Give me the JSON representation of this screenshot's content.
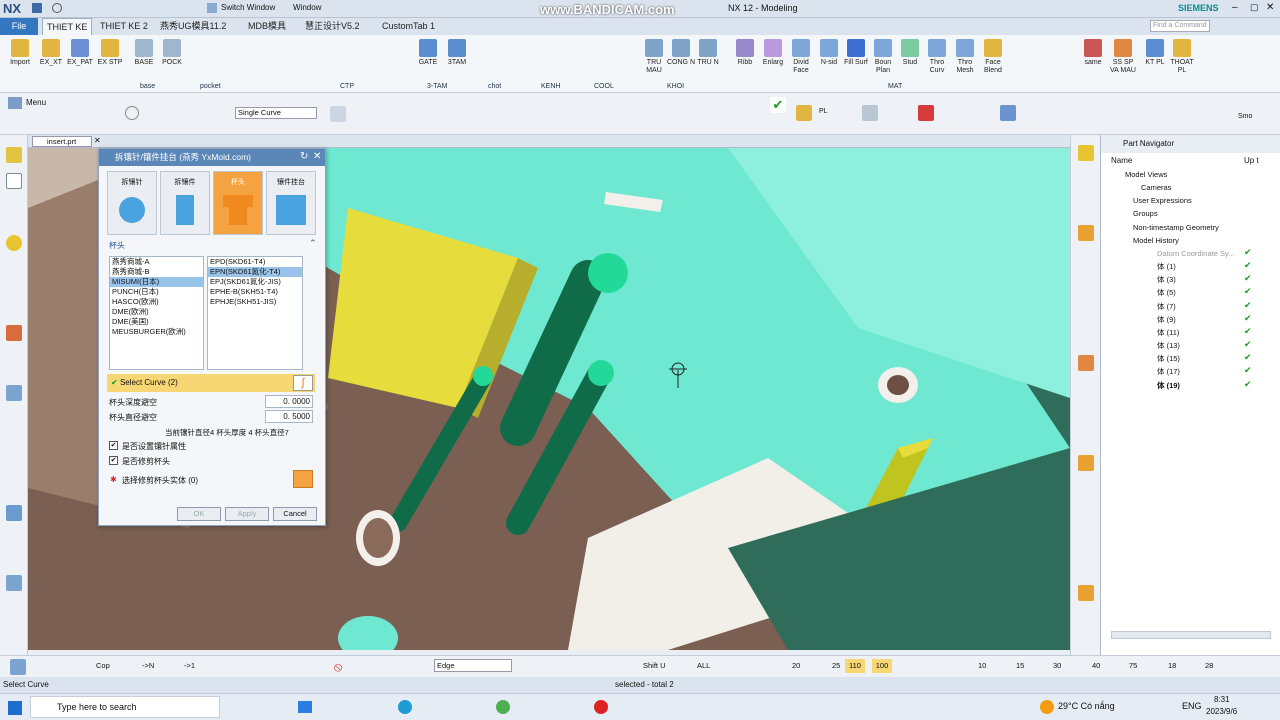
{
  "window": {
    "app_logo": "NX",
    "title": "NX 12 - Modeling",
    "brand": "SIEMENS",
    "watermark": "www.BANDICAM.com",
    "search_placeholder": "Find a Command",
    "switch_window": "Switch Window",
    "window_menu": "Window"
  },
  "tabs": [
    "File",
    "THIET KE",
    "THIET KE 2",
    "燕秀UG模具11.2",
    "MDB模具",
    "慧正设计V5.2",
    "CustomTab 1"
  ],
  "ribbon_buttons": [
    "Import",
    "EX_XT",
    "EX_PAT",
    "EX STP",
    "BASE",
    "POCK",
    "GATE",
    "3TAM",
    "TRU MAU",
    "CONG N",
    "TRU N",
    "Ribb",
    "Enlarg",
    "Divid Face",
    "N-sid",
    "Fill Surf",
    "Boun Plan",
    "Stud",
    "Thro Curv",
    "Thro Mesh",
    "Face Blend",
    "same",
    "SS SP VA MAU",
    "KT PL",
    "THOAT PL"
  ],
  "ribbon_groups": [
    "base",
    "pocket",
    "CTP",
    "3-TAM",
    "chot",
    "KENH",
    "COOL",
    "KHOI",
    "MAT"
  ],
  "toolbar": {
    "menu": "Menu",
    "curve_rule": "Single Curve",
    "pl_label": "PL",
    "smo_label": "Smo"
  },
  "doc_tab": "insert.prt",
  "dialog": {
    "title": "拆镶针/镶件挂台 (燕秀 YxMold.com)",
    "types": [
      "拆镶针",
      "拆镶件",
      "杯头",
      "镶件挂台"
    ],
    "section": "杯头",
    "vendors": [
      "燕秀商城-A",
      "燕秀商城-B",
      "MISUMI(日本)",
      "PUNCH(日本)",
      "HASCO(欧洲)",
      "DME(欧洲)",
      "DME(美国)",
      "MEUSBURGER(欧洲)"
    ],
    "vendor_selected": 2,
    "parts": [
      "EPD(SKD61-T4)",
      "EPN(SKD61氮化-T4)",
      "EPJ(SKD61氮化-JIS)",
      "EPHE-B(SKH51-T4)",
      "EPHJE(SKH51-JIS)"
    ],
    "part_selected": 1,
    "select_curve": "Select Curve (2)",
    "depth_label": "杯头深度避空",
    "depth_value": "0. 0000",
    "dia_label": "杯头直径避空",
    "dia_value": "0. 5000",
    "info": "当前镶针直径4  杯头厚度 4  杯头直径7",
    "opt1": "是否设置镶针属性",
    "opt2": "是否修剪杯头",
    "select_body": "选择修剪杯头实体 (0)",
    "ok": "OK",
    "apply": "Apply",
    "cancel": "Cancel"
  },
  "part_navigator": {
    "title": "Part Navigator",
    "col_name": "Name",
    "col_up": "Up t",
    "items": [
      "Model Views",
      "Cameras",
      "User Expressions",
      "Groups",
      "Non-timestamp Geometry",
      "Model History",
      "Datum Coordinate Sy...",
      "体 (1)",
      "体 (3)",
      "体 (5)",
      "体 (7)",
      "体 (9)",
      "体 (11)",
      "体 (13)",
      "体 (15)",
      "体 (17)",
      "体 (19)"
    ]
  },
  "bottom_toolbar": {
    "cop": "Cop",
    "n": "->N",
    "one": "->1",
    "edge_filter": "Edge",
    "shift": "Shift U",
    "all": "ALL",
    "nums": [
      "20",
      "25",
      "110",
      "100",
      "10",
      "15",
      "30",
      "40",
      "75",
      "18",
      "28"
    ]
  },
  "status": {
    "left": "Select Curve",
    "center": "selected - total 2"
  },
  "taskbar": {
    "search": "Type here to search",
    "weather": "29°C  Có nắng",
    "lang": "ENG",
    "time": "8:31",
    "date": "2023/9/6"
  },
  "colors": {
    "accent": "#3377c0",
    "viewport_cyan": "#6fe8d2",
    "dark_green": "#2f6d5a",
    "pin_green": "#0f6b48",
    "mold_brown": "#8a6a58",
    "yellow": "#e6dc3c",
    "selected_tab": "#f4a340"
  }
}
